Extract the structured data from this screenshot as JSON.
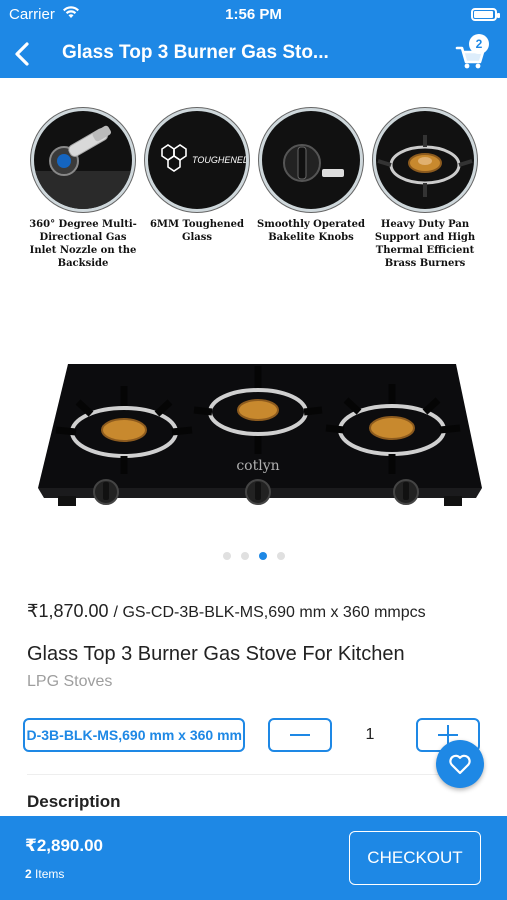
{
  "status": {
    "carrier": "Carrier",
    "time": "1:56 PM"
  },
  "nav": {
    "title": "Glass Top 3 Burner Gas Sto...",
    "cart_count": "2"
  },
  "gallery": {
    "features": [
      {
        "caption": "360° Degree Multi-Directional Gas Inlet Nozzle on the Backside"
      },
      {
        "caption": "6MM Toughened Glass",
        "bubble_text": "TOUGHENED GLASS"
      },
      {
        "caption": "Smoothly Operated Bakelite Knobs"
      },
      {
        "caption": "Heavy Duty Pan Support and High Thermal Efficient Brass Burners"
      }
    ],
    "brand": "cotlyn",
    "page_count": 4,
    "active_page": 3
  },
  "product": {
    "price": "₹1,870.00",
    "sku_text": "/ GS-CD-3B-BLK-MS,690 mm x 360 mmpcs",
    "name": "Glass Top 3 Burner Gas Stove For Kitchen",
    "category": "LPG Stoves",
    "variant": "D-3B-BLK-MS,690 mm x 360 mm",
    "quantity": "1",
    "description_title": "Description"
  },
  "checkout": {
    "total": "₹2,890.00",
    "item_count": "2",
    "items_label": "Items",
    "button_label": "CHECKOUT"
  },
  "colors": {
    "accent": "#1e88e5",
    "white": "#ffffff"
  }
}
